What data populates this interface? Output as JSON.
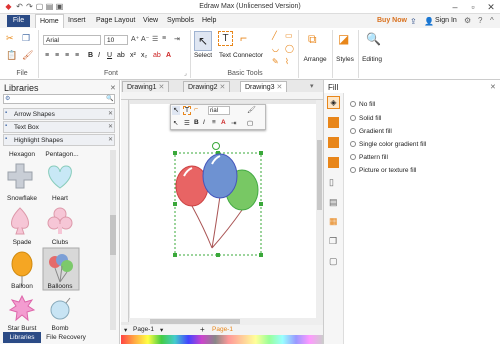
{
  "title": "Edraw Max (Unlicensed Version)",
  "menu": {
    "file": "File",
    "home": "Home",
    "insert": "Insert",
    "page_layout": "Page Layout",
    "view": "View",
    "symbols": "Symbols",
    "help": "Help",
    "buy_now": "Buy Now",
    "sign_in": "Sign In"
  },
  "ribbon": {
    "font_name": "Arial",
    "font_size": "10",
    "groups": {
      "file": "File",
      "font": "Font",
      "basic_tools": "Basic Tools"
    },
    "select": "Select",
    "text": "Text",
    "connector": "Connector",
    "arrange": "Arrange",
    "styles": "Styles",
    "editing": "Editing"
  },
  "libraries": {
    "title": "Libraries",
    "categories": [
      "Arrow Shapes",
      "Text Box",
      "Highlight Shapes"
    ],
    "top_labels": [
      "Hexagon",
      "Pentagon..."
    ],
    "shapes": [
      "Snowflake",
      "Heart",
      "Spade",
      "Clubs",
      "Balloon",
      "Balloons",
      "Star Burst",
      "Bomb"
    ],
    "bottom_tabs": [
      "Libraries",
      "File Recovery"
    ]
  },
  "doc_tabs": [
    "Drawing1",
    "Drawing2",
    "Drawing3"
  ],
  "float_font": "rial",
  "page_tab": "Page-1",
  "page_tab_active": "Page-1",
  "fill": {
    "title": "Fill",
    "options": [
      "No fill",
      "Solid fill",
      "Gradient fill",
      "Single color gradient fill",
      "Pattern fill",
      "Picture or texture fill"
    ]
  }
}
